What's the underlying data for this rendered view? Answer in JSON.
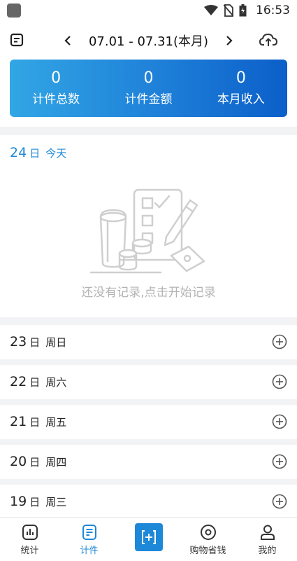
{
  "status": {
    "time": "16:53"
  },
  "header": {
    "range": "07.01 - 07.31(本月)"
  },
  "summary": [
    {
      "value": "0",
      "label": "计件总数"
    },
    {
      "value": "0",
      "label": "计件金额"
    },
    {
      "value": "0",
      "label": "本月收入"
    }
  ],
  "today": {
    "day": "24",
    "unit": "日",
    "weekday": "今天",
    "empty_text": "还没有记录,点击开始记录"
  },
  "days": [
    {
      "day": "23",
      "unit": "日",
      "weekday": "周日"
    },
    {
      "day": "22",
      "unit": "日",
      "weekday": "周六"
    },
    {
      "day": "21",
      "unit": "日",
      "weekday": "周五"
    },
    {
      "day": "20",
      "unit": "日",
      "weekday": "周四"
    },
    {
      "day": "19",
      "unit": "日",
      "weekday": "周三"
    }
  ],
  "nav": [
    {
      "label": "统计",
      "icon": "bar-chart-icon"
    },
    {
      "label": "计件",
      "icon": "document-list-icon"
    },
    {
      "label": "",
      "icon": "add-record-icon"
    },
    {
      "label": "购物省钱",
      "icon": "disc-icon"
    },
    {
      "label": "我的",
      "icon": "user-icon"
    }
  ],
  "colors": {
    "accent": "#1e88d8",
    "gradient_start": "#32a6e5",
    "gradient_end": "#0b5fc9"
  }
}
